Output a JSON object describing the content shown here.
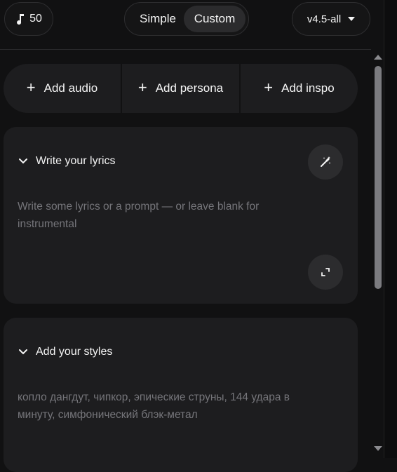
{
  "header": {
    "credits": "50",
    "mode_simple": "Simple",
    "mode_custom": "Custom",
    "version": "v4.5-all"
  },
  "add_row": {
    "audio": "Add audio",
    "persona": "Add persona",
    "inspo": "Add inspo"
  },
  "lyrics": {
    "title": "Write your lyrics",
    "placeholder": "Write some lyrics or a prompt — or leave blank for instrumental"
  },
  "styles": {
    "title": "Add your styles",
    "text": "копло дангдут, чипкор, эпические струны, 144 удара в минуту, симфонический блэк-метал"
  },
  "colors": {
    "background": "#111112",
    "panel": "#1d1d1f",
    "active_tab": "#2b2b2d",
    "muted_text": "#75757a"
  },
  "icons": [
    "music-note-icon",
    "caret-down-icon",
    "plus-icon",
    "chevron-down-icon",
    "magic-wand-icon",
    "expand-icon"
  ]
}
